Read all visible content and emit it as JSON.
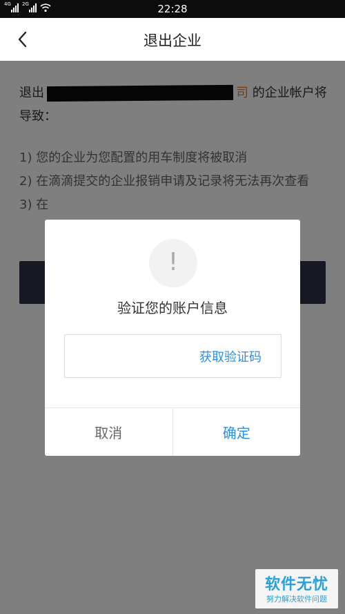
{
  "status_bar": {
    "time": "22:28",
    "signal1_label": "4G",
    "signal2_label": "2G"
  },
  "header": {
    "title": "退出企业"
  },
  "content": {
    "desc_prefix": "退出",
    "company_tail": "司",
    "desc_suffix": "的企业帐户将导致：",
    "items": [
      "1) 您的企业为您配置的用车制度将被取消",
      "2) 在滴滴提交的企业报销申请及记录将无法再次查看",
      "3) 在"
    ]
  },
  "dialog": {
    "icon_glyph": "!",
    "title": "验证您的账户信息",
    "code_input": {
      "value": "",
      "placeholder": ""
    },
    "get_code_label": "获取验证码",
    "cancel_label": "取消",
    "confirm_label": "确定"
  },
  "watermark": {
    "main": "软件无忧",
    "sub": "努力解决软件问题"
  },
  "colors": {
    "accent_blue": "#2b8fe6",
    "button_dark": "#2c3146",
    "company_orange": "#d9822b"
  }
}
